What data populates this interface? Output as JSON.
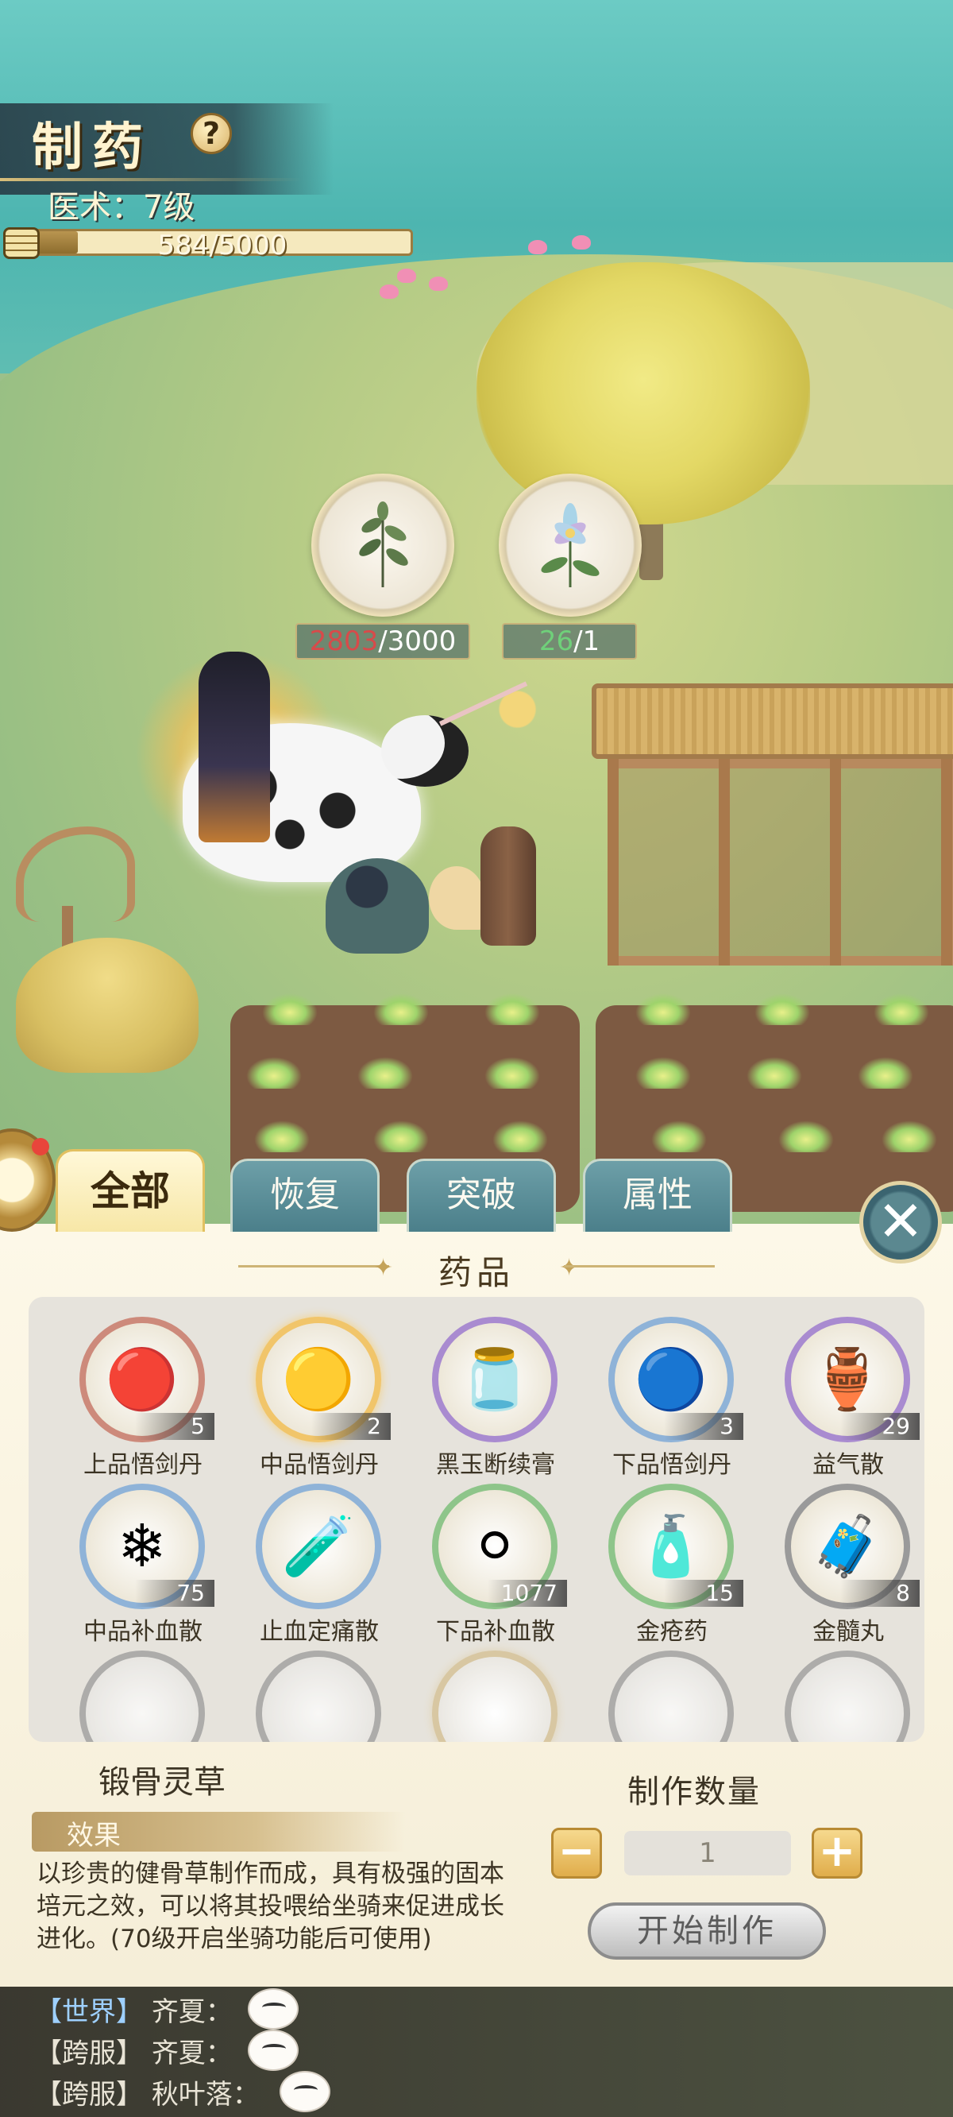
{
  "hud": {
    "title": "制药",
    "help_icon": "?",
    "skill_label": "医术：7级",
    "exp_text": "584/5000",
    "exp_fraction": 0.1168
  },
  "herbs": [
    {
      "icon": "leaf-branch-herb",
      "count_have": "2803",
      "count_need": "/3000"
    },
    {
      "icon": "blue-flower-herb",
      "count_have": "26",
      "count_need": "/1"
    }
  ],
  "tabs": [
    {
      "label": "全部",
      "active": true
    },
    {
      "label": "恢复",
      "active": false
    },
    {
      "label": "突破",
      "active": false
    },
    {
      "label": "属性",
      "active": false
    }
  ],
  "section_title": "药品",
  "items": [
    {
      "name": "上品悟剑丹",
      "qty": "5",
      "ring": "red",
      "glyph": "🔴"
    },
    {
      "name": "中品悟剑丹",
      "qty": "2",
      "ring": "gold",
      "glyph": "🟡"
    },
    {
      "name": "黑玉断续膏",
      "qty": "",
      "ring": "purple",
      "glyph": "🫙"
    },
    {
      "name": "下品悟剑丹",
      "qty": "3",
      "ring": "blue",
      "glyph": "🔵"
    },
    {
      "name": "益气散",
      "qty": "29",
      "ring": "purple",
      "glyph": "🏺"
    },
    {
      "name": "中品补血散",
      "qty": "75",
      "ring": "blue",
      "glyph": "❄"
    },
    {
      "name": "止血定痛散",
      "qty": "",
      "ring": "blue",
      "glyph": "🧪"
    },
    {
      "name": "下品补血散",
      "qty": "1077",
      "ring": "green",
      "glyph": "⚪"
    },
    {
      "name": "金疮药",
      "qty": "15",
      "ring": "green",
      "glyph": "🧴"
    },
    {
      "name": "金髓丸",
      "qty": "8",
      "ring": "grey",
      "glyph": "🧳"
    }
  ],
  "selected": {
    "name": "锻骨灵草",
    "effect_label": "效果",
    "effect_text": "以珍贵的健骨草制作而成，具有极强的固本培元之效，可以将其投喂给坐骑来促进成长进化。(70级开启坐骑功能后可使用)"
  },
  "craft": {
    "qty_title": "制作数量",
    "minus": "−",
    "plus": "+",
    "qty_value": "1",
    "start_label": "开始制作"
  },
  "close_icon": "✕",
  "chat": [
    {
      "channel": "【世界】",
      "name": "齐夏："
    },
    {
      "channel": "【跨服】",
      "name": "齐夏："
    },
    {
      "channel": "【跨服】",
      "name": "秋叶落："
    }
  ]
}
